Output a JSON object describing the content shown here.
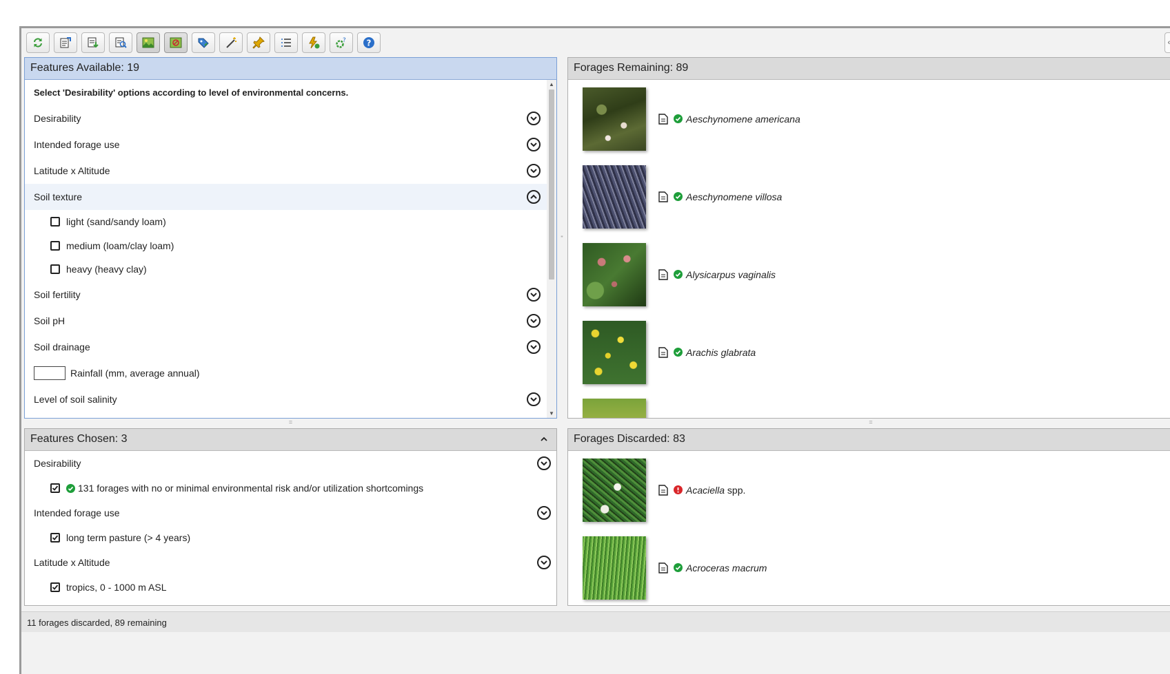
{
  "available": {
    "title": "Features Available: 19",
    "instruction": "Select 'Desirability' options according to level of environmental concerns.",
    "rows": {
      "desirability": "Desirability",
      "intended_use": "Intended forage use",
      "lat_alt": "Latitude x Altitude",
      "soil_texture": "Soil texture",
      "soil_fertility": "Soil fertility",
      "soil_ph": "Soil pH",
      "soil_drainage": "Soil drainage",
      "rainfall": "Rainfall (mm, average annual)",
      "salinity": "Level of soil salinity"
    },
    "soil_texture_options": [
      "light (sand/sandy loam)",
      "medium (loam/clay loam)",
      "heavy (heavy clay)"
    ]
  },
  "remaining": {
    "title": "Forages Remaining: 89",
    "items": [
      "Aeschynomene americana",
      "Aeschynomene villosa",
      "Alysicarpus vaginalis",
      "Arachis glabrata"
    ]
  },
  "chosen": {
    "title": "Features Chosen: 3",
    "groups": [
      {
        "label": "Desirability",
        "option": "131 forages with no or minimal environmental risk and/or utilization shortcomings"
      },
      {
        "label": "Intended forage use",
        "option": "long term pasture (> 4 years)"
      },
      {
        "label": "Latitude x Altitude",
        "option": "tropics, 0 - 1000 m ASL"
      }
    ]
  },
  "discarded": {
    "title": "Forages Discarded: 83",
    "items": [
      {
        "genus": "Acaciella",
        "suffix": " spp.",
        "status": "warning"
      },
      {
        "genus": "Acroceras macrum",
        "suffix": "",
        "status": "ok"
      }
    ]
  },
  "status_bar": "11 forages discarded, 89 remaining",
  "colors": {
    "ok": "#1e9e3a",
    "warning": "#d9262a",
    "panel_header_active": "#c9d8ef",
    "panel_header": "#dadada"
  },
  "toolbar_icons": [
    "refresh-icon",
    "export-icon",
    "download-icon",
    "search-list-icon",
    "image-view-icon",
    "image-compare-icon",
    "tag-icon",
    "wand-icon",
    "pin-icon",
    "list-icon",
    "filter-lightning-icon",
    "help-settings-icon",
    "help-icon"
  ]
}
